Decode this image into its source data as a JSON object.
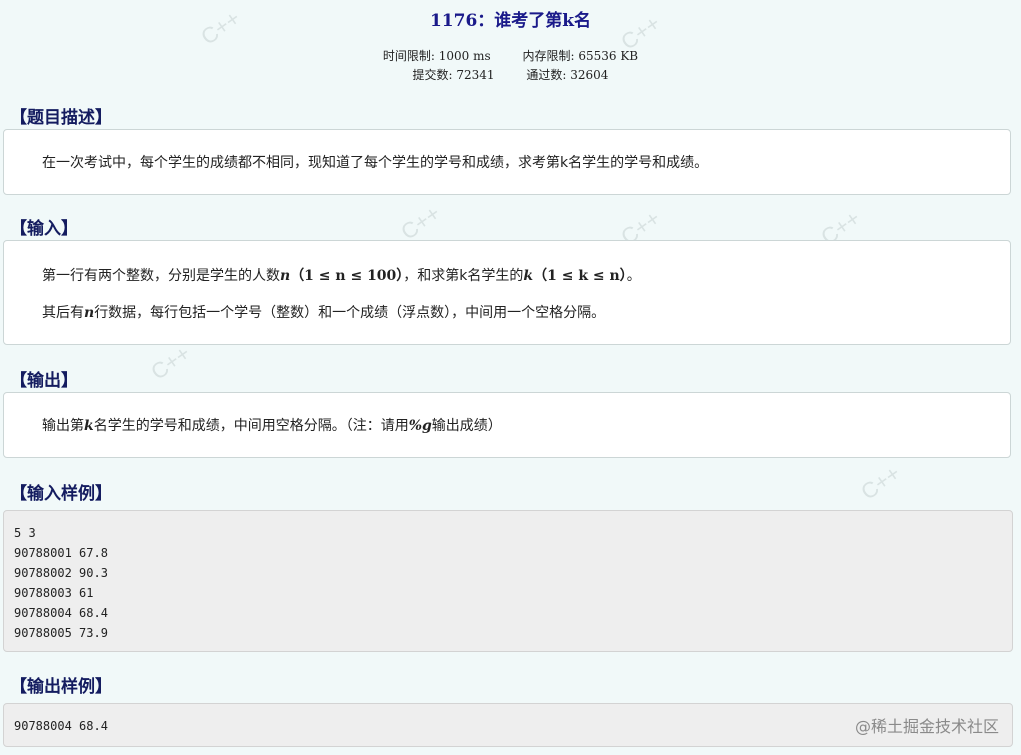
{
  "problem": {
    "title": "1176：谁考了第k名",
    "time_limit": "时间限制: 1000 ms",
    "memory_limit": "内存限制: 65536 KB",
    "submissions": "提交数: 72341",
    "accepted": "通过数: 32604"
  },
  "sections": {
    "description_head": "【题目描述】",
    "description_text": "在一次考试中，每个学生的成绩都不相同，现知道了每个学生的学号和成绩，求考第k名学生的学号和成绩。",
    "input_head": "【输入】",
    "input_line1_a": "第一行有两个整数，分别是学生的人数",
    "input_line1_n": "n",
    "input_line1_range_n": "（1 ≤ n ≤ 100）",
    "input_line1_b": "，和求第k名学生的",
    "input_line1_k": "k",
    "input_line1_range_k": "（1 ≤ k ≤ n）",
    "input_line1_c": "。",
    "input_line2_a": "其后有",
    "input_line2_n": "n",
    "input_line2_b": "行数据，每行包括一个学号（整数）和一个成绩（浮点数），中间用一个空格分隔。",
    "output_head": "【输出】",
    "output_a": "输出第",
    "output_k": "k",
    "output_b": "名学生的学号和成绩，中间用空格分隔。（注：请用",
    "output_fmt": "%g",
    "output_c": "输出成绩）",
    "sample_input_head": "【输入样例】",
    "sample_input": "5 3\n90788001 67.8\n90788002 90.3\n90788003 61\n90788004 68.4\n90788005 73.9",
    "sample_output_head": "【输出样例】",
    "sample_output": "90788004 68.4"
  },
  "watermark": "C++",
  "credit": "@稀土掘金技术社区"
}
